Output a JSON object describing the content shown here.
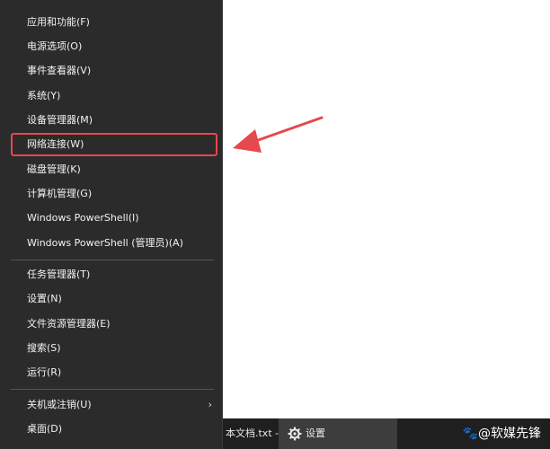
{
  "menu": {
    "items": [
      {
        "label": "应用和功能(F)"
      },
      {
        "label": "电源选项(O)"
      },
      {
        "label": "事件查看器(V)"
      },
      {
        "label": "系统(Y)"
      },
      {
        "label": "设备管理器(M)"
      },
      {
        "label": "网络连接(W)"
      },
      {
        "label": "磁盘管理(K)"
      },
      {
        "label": "计算机管理(G)"
      },
      {
        "label": "Windows PowerShell(I)"
      },
      {
        "label": "Windows PowerShell (管理员)(A)"
      },
      {
        "label": "任务管理器(T)"
      },
      {
        "label": "设置(N)"
      },
      {
        "label": "文件资源管理器(E)"
      },
      {
        "label": "搜索(S)"
      },
      {
        "label": "运行(R)"
      },
      {
        "label": "关机或注销(U)"
      },
      {
        "label": "桌面(D)"
      }
    ],
    "highlighted_item": "网络连接(W)"
  },
  "annotation": {
    "arrow_color": "#e5484d"
  },
  "taskbar": {
    "notepad_label": "本文档.txt -...",
    "settings_label": "设置"
  },
  "watermark": "🐾@软媒先锋"
}
